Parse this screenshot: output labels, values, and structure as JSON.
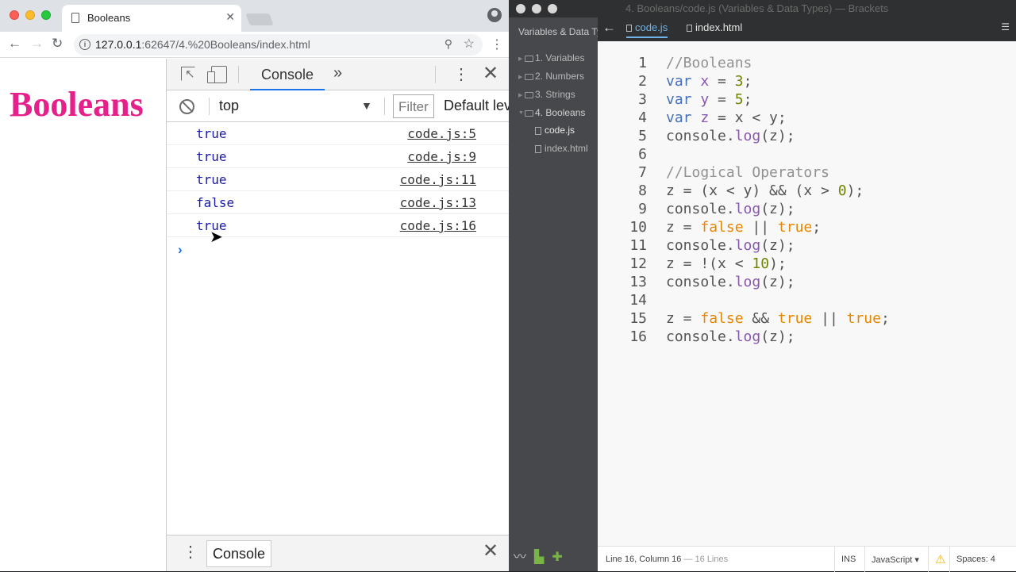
{
  "browser": {
    "tab_title": "Booleans",
    "url_host": "127.0.0.1",
    "url_rest": ":62647/4.%20Booleans/index.html",
    "page_heading": "Booleans",
    "devtools": {
      "active_tab": "Console",
      "more_tabs_glyph": "»",
      "context": "top",
      "filter_placeholder": "Filter",
      "levels_label": "Default levels",
      "logs": [
        {
          "value": "true",
          "source": "code.js:5"
        },
        {
          "value": "true",
          "source": "code.js:9"
        },
        {
          "value": "true",
          "source": "code.js:11"
        },
        {
          "value": "false",
          "source": "code.js:13"
        },
        {
          "value": "true",
          "source": "code.js:16"
        }
      ],
      "prompt_glyph": "›",
      "drawer_tab": "Console"
    }
  },
  "editor": {
    "window_title": "4. Booleans/code.js (Variables & Data Types) — Brackets",
    "project_name": "Variables & Data Types",
    "tree": [
      {
        "label": "1. Variables"
      },
      {
        "label": "2. Numbers"
      },
      {
        "label": "3. Strings"
      },
      {
        "label": "4. Booleans"
      },
      {
        "label": "code.js"
      },
      {
        "label": "index.html"
      }
    ],
    "tabs": [
      {
        "label": "code.js"
      },
      {
        "label": "index.html"
      }
    ],
    "code_lines": [
      [
        [
          "c-cmt",
          "//Booleans"
        ]
      ],
      [
        [
          "c-kw",
          "var "
        ],
        [
          "c-var",
          "x"
        ],
        [
          "c-txt",
          " = "
        ],
        [
          "c-num",
          "3"
        ],
        [
          "c-txt",
          ";"
        ]
      ],
      [
        [
          "c-kw",
          "var "
        ],
        [
          "c-var",
          "y"
        ],
        [
          "c-txt",
          " = "
        ],
        [
          "c-num",
          "5"
        ],
        [
          "c-txt",
          ";"
        ]
      ],
      [
        [
          "c-kw",
          "var "
        ],
        [
          "c-var",
          "z"
        ],
        [
          "c-txt",
          " = x < y;"
        ]
      ],
      [
        [
          "c-txt",
          "console."
        ],
        [
          "c-var",
          "log"
        ],
        [
          "c-txt",
          "(z);"
        ]
      ],
      [],
      [
        [
          "c-cmt",
          "//Logical Operators"
        ]
      ],
      [
        [
          "c-txt",
          "z = (x < y) && (x > "
        ],
        [
          "c-num",
          "0"
        ],
        [
          "c-txt",
          ");"
        ]
      ],
      [
        [
          "c-txt",
          "console."
        ],
        [
          "c-var",
          "log"
        ],
        [
          "c-txt",
          "(z);"
        ]
      ],
      [
        [
          "c-txt",
          "z = "
        ],
        [
          "c-lit",
          "false"
        ],
        [
          "c-txt",
          " || "
        ],
        [
          "c-lit",
          "true"
        ],
        [
          "c-txt",
          ";"
        ]
      ],
      [
        [
          "c-txt",
          "console."
        ],
        [
          "c-var",
          "log"
        ],
        [
          "c-txt",
          "(z);"
        ]
      ],
      [
        [
          "c-txt",
          "z = !(x < "
        ],
        [
          "c-num",
          "10"
        ],
        [
          "c-txt",
          ");"
        ]
      ],
      [
        [
          "c-txt",
          "console."
        ],
        [
          "c-var",
          "log"
        ],
        [
          "c-txt",
          "(z);"
        ]
      ],
      [],
      [
        [
          "c-txt",
          "z = "
        ],
        [
          "c-lit",
          "false"
        ],
        [
          "c-txt",
          " && "
        ],
        [
          "c-lit",
          "true"
        ],
        [
          "c-txt",
          " || "
        ],
        [
          "c-lit",
          "true"
        ],
        [
          "c-txt",
          ";"
        ]
      ],
      [
        [
          "c-txt",
          "console."
        ],
        [
          "c-var",
          "log"
        ],
        [
          "c-txt",
          "(z);"
        ]
      ]
    ],
    "status": {
      "position": "Line 16, Column 16",
      "lines": "— 16 Lines",
      "mode": "INS",
      "language": "JavaScript",
      "spaces": "Spaces: 4"
    }
  }
}
